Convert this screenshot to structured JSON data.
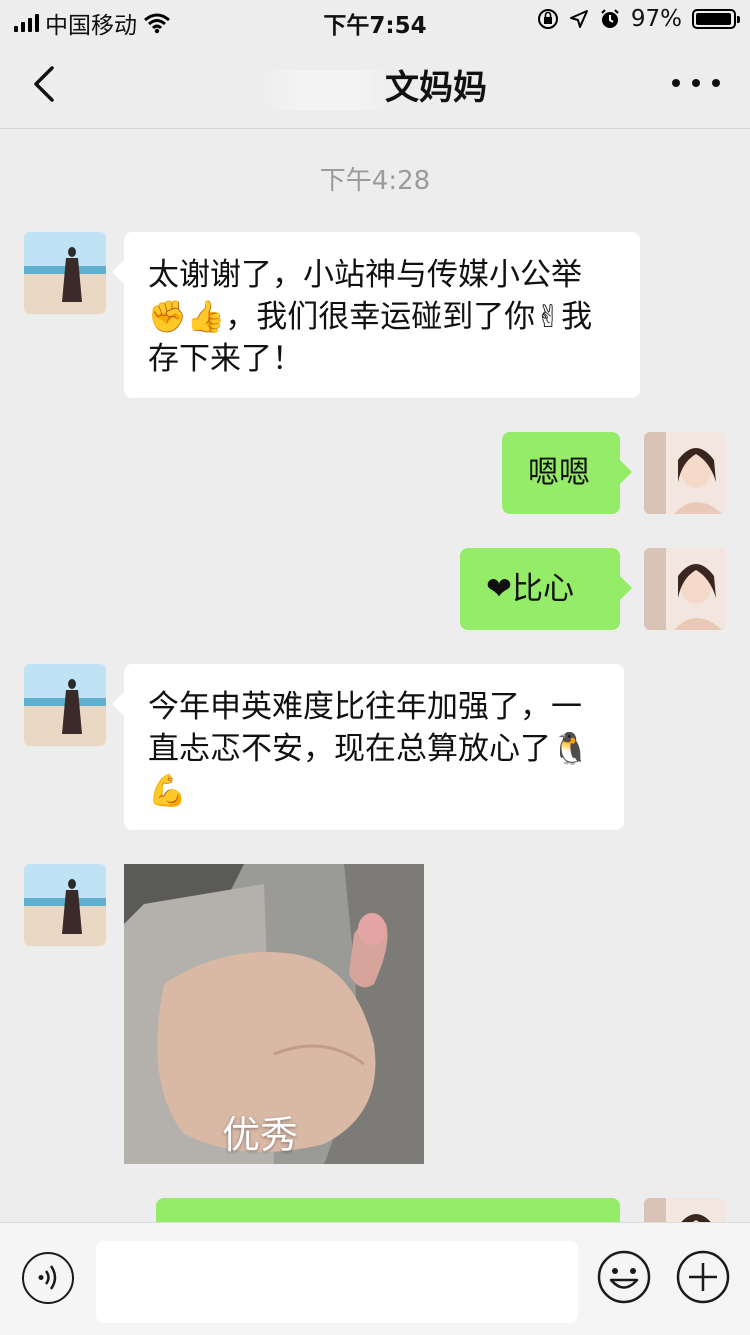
{
  "status_bar": {
    "carrier": "中国移动",
    "time": "下午7:54",
    "battery": "97%",
    "battery_level": 0.97
  },
  "nav": {
    "title_visible": "文妈妈",
    "back_icon": "chevron-left-icon",
    "more_icon": "more-dots-icon"
  },
  "timestamp": "下午4:28",
  "messages": [
    {
      "side": "left",
      "text": "太谢谢了，小站神与传媒小公举✊👍，我们很幸运碰到了你✌我存下来了！"
    },
    {
      "side": "right",
      "text": "嗯嗯"
    },
    {
      "side": "right",
      "text": "❤比心"
    },
    {
      "side": "left",
      "text": "今年申英难度比往年加强了，一直忐忑不安，现在总算放心了🐧💪"
    },
    {
      "side": "left",
      "type": "image",
      "caption": "优秀"
    }
  ],
  "input_bar": {
    "voice_icon": "voice-icon",
    "emoji_icon": "emoji-icon",
    "plus_icon": "plus-icon"
  },
  "colors": {
    "background": "#ededed",
    "bubble_green": "#95ec69",
    "bubble_white": "#ffffff"
  }
}
